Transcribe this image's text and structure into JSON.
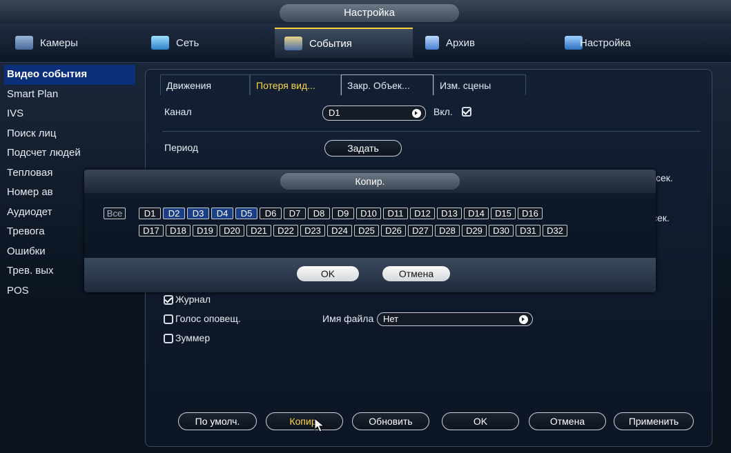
{
  "window": {
    "title": "Настройка"
  },
  "tabs": [
    {
      "label": "Камеры",
      "icon": "camera-icon",
      "active": false
    },
    {
      "label": "Сеть",
      "icon": "network-icon",
      "active": false
    },
    {
      "label": "События",
      "icon": "events-icon",
      "active": true
    },
    {
      "label": "Архив",
      "icon": "archive-icon",
      "active": false
    },
    {
      "label": "Настройка",
      "icon": "settings-icon",
      "active": false
    }
  ],
  "sidebar": {
    "items": [
      {
        "label": "Видео события",
        "active": true
      },
      {
        "label": "Smart Plan",
        "active": false
      },
      {
        "label": "IVS",
        "active": false
      },
      {
        "label": "Поиск лиц",
        "active": false
      },
      {
        "label": "Подсчет людей",
        "active": false
      },
      {
        "label": "Тепловая",
        "active": false
      },
      {
        "label": "Номер ав",
        "active": false
      },
      {
        "label": "Аудиодет",
        "active": false
      },
      {
        "label": "Тревога",
        "active": false
      },
      {
        "label": "Ошибки",
        "active": false
      },
      {
        "label": "Трев. вых",
        "active": false
      },
      {
        "label": "POS",
        "active": false
      }
    ]
  },
  "subtabs": [
    {
      "label": "Движения",
      "active": false
    },
    {
      "label": "Потеря вид...",
      "active": true
    },
    {
      "label": "Закр. Объек...",
      "active": false
    },
    {
      "label": "Изм. сцены",
      "active": false
    }
  ],
  "form": {
    "channel_label": "Канал",
    "channel_value": "D1",
    "enable_label": "Вкл.",
    "enable_checked": true,
    "period_label": "Период",
    "period_button": "Задать",
    "sec_label_1": "сек.",
    "sec_label_2": "сек.",
    "log_label": "Журнал",
    "log_checked": true,
    "voice_label": "Голос оповещ.",
    "voice_checked": false,
    "filename_label": "Имя файла",
    "filename_value": "Нет",
    "buzzer_label": "Зуммер",
    "buzzer_checked": false
  },
  "footer": {
    "default": "По умолч.",
    "copy": "Копир.",
    "refresh": "Обновить",
    "ok": "OK",
    "cancel": "Отмена",
    "apply": "Применить"
  },
  "dialog": {
    "title": "Копир.",
    "all_label": "Все",
    "channels_row1": [
      "D1",
      "D2",
      "D3",
      "D4",
      "D5",
      "D6",
      "D7",
      "D8",
      "D9",
      "D10",
      "D11",
      "D12",
      "D13",
      "D14",
      "D15",
      "D16"
    ],
    "channels_row2": [
      "D17",
      "D18",
      "D19",
      "D20",
      "D21",
      "D22",
      "D23",
      "D24",
      "D25",
      "D26",
      "D27",
      "D28",
      "D29",
      "D30",
      "D31",
      "D32"
    ],
    "selected": [
      "D2",
      "D3",
      "D4",
      "D5"
    ],
    "ok": "OK",
    "cancel": "Отмена"
  },
  "colors": {
    "accent": "#ffd64a",
    "selected": "#0b2f78",
    "dialog_selected": "#1b3f86"
  }
}
